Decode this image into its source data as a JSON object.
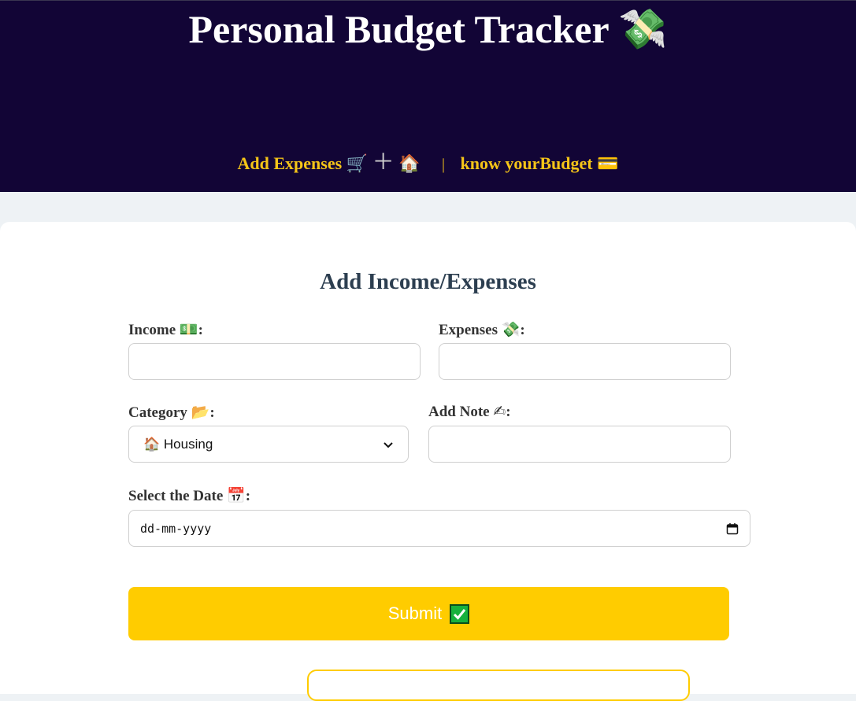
{
  "header": {
    "title": "Personal Budget Tracker",
    "title_icon": "money-with-wings-icon",
    "nav": {
      "add_expenses_label": "Add Expenses",
      "add_expenses_icons": [
        "shopping-cart-icon",
        "plus-icon",
        "house-icon"
      ],
      "separator": "|",
      "know_budget_label": "know yourBudget",
      "know_budget_icon": "credit-card-icon"
    }
  },
  "form": {
    "title": "Add Income/Expenses",
    "income": {
      "label": "Income",
      "icon": "dollar-banknote-icon",
      "value": ""
    },
    "expenses": {
      "label": "Expenses",
      "icon": "money-with-wings-icon",
      "value": ""
    },
    "category": {
      "label": "Category",
      "icon": "folder-icon",
      "selected": "Housing",
      "selected_icon": "house-icon"
    },
    "note": {
      "label": "Add Note",
      "icon": "writing-hand-icon",
      "value": ""
    },
    "date": {
      "label": "Select the Date",
      "icon": "calendar-icon",
      "placeholder": "dd-mm-yyyy"
    },
    "submit_label": "Submit",
    "submit_icon": "check-mark-button-icon"
  },
  "colors": {
    "header_bg": "#120536",
    "accent": "#ffcc00",
    "nav_text": "#f5c518",
    "title_text": "#2c3e50"
  }
}
